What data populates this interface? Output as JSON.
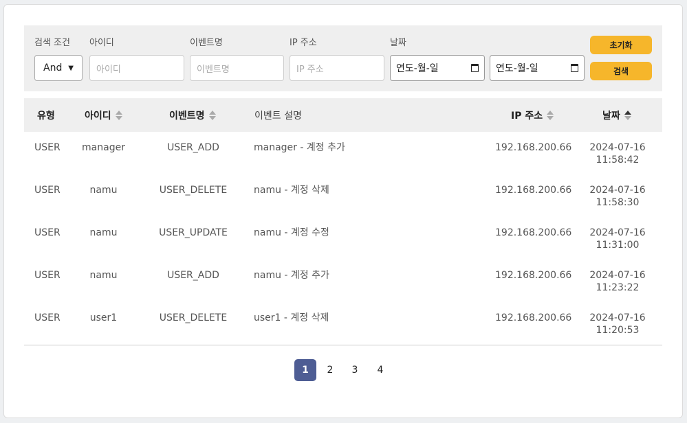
{
  "filters": {
    "condition_label": "검색 조건",
    "condition_value": "And",
    "id_label": "아이디",
    "id_placeholder": "아이디",
    "event_label": "이벤트명",
    "event_placeholder": "이벤트명",
    "ip_label": "IP 주소",
    "ip_placeholder": "IP 주소",
    "date_label": "날짜",
    "date_from": "연도-월-일",
    "date_to": "연도-월-일",
    "reset_label": "초기화",
    "search_label": "검색"
  },
  "table": {
    "headers": {
      "type": "유형",
      "id": "아이디",
      "event": "이벤트명",
      "desc": "이벤트 설명",
      "ip": "IP 주소",
      "date": "날짜"
    },
    "rows": [
      {
        "type": "USER",
        "id": "manager",
        "event": "USER_ADD",
        "desc": "manager - 계정 추가",
        "ip": "192.168.200.66",
        "date": "2024-07-16",
        "time": "11:58:42"
      },
      {
        "type": "USER",
        "id": "namu",
        "event": "USER_DELETE",
        "desc": "namu - 계정 삭제",
        "ip": "192.168.200.66",
        "date": "2024-07-16",
        "time": "11:58:30"
      },
      {
        "type": "USER",
        "id": "namu",
        "event": "USER_UPDATE",
        "desc": "namu - 계정 수정",
        "ip": "192.168.200.66",
        "date": "2024-07-16",
        "time": "11:31:00"
      },
      {
        "type": "USER",
        "id": "namu",
        "event": "USER_ADD",
        "desc": "namu - 계정 추가",
        "ip": "192.168.200.66",
        "date": "2024-07-16",
        "time": "11:23:22"
      },
      {
        "type": "USER",
        "id": "user1",
        "event": "USER_DELETE",
        "desc": "user1 - 계정 삭제",
        "ip": "192.168.200.66",
        "date": "2024-07-16",
        "time": "11:20:53"
      }
    ]
  },
  "pagination": {
    "pages": [
      "1",
      "2",
      "3",
      "4"
    ],
    "current": "1"
  },
  "colors": {
    "accent_button": "#f6b62b",
    "active_page": "#4e5d94"
  }
}
